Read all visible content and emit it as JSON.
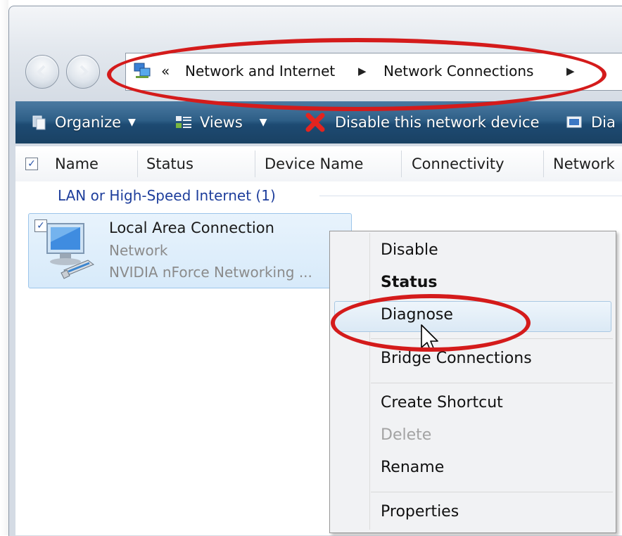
{
  "address_bar": {
    "overflow_glyph": "«",
    "crumbs": [
      "Network and Internet",
      "Network Connections"
    ]
  },
  "toolbar": {
    "organize": "Organize",
    "views": "Views",
    "disable_device": "Disable this network device",
    "diagnose_partial": "Dia"
  },
  "columns": [
    "Name",
    "Status",
    "Device Name",
    "Connectivity",
    "Network"
  ],
  "group": {
    "label": "LAN or High-Speed Internet (1)"
  },
  "connection": {
    "name": "Local Area Connection",
    "type": "Network",
    "device": "NVIDIA nForce Networking ..."
  },
  "context_menu": {
    "items": [
      "Disable",
      "Status",
      "Diagnose",
      "Bridge Connections",
      "Create Shortcut",
      "Delete",
      "Rename",
      "Properties"
    ],
    "default_item": "Status",
    "highlighted_item": "Diagnose",
    "disabled_item": "Delete"
  },
  "colors": {
    "toolbar": "#2e5f87",
    "annotation_red": "#d41b1b",
    "group_text": "#1e3e9c",
    "selection": "#d7eafa"
  }
}
